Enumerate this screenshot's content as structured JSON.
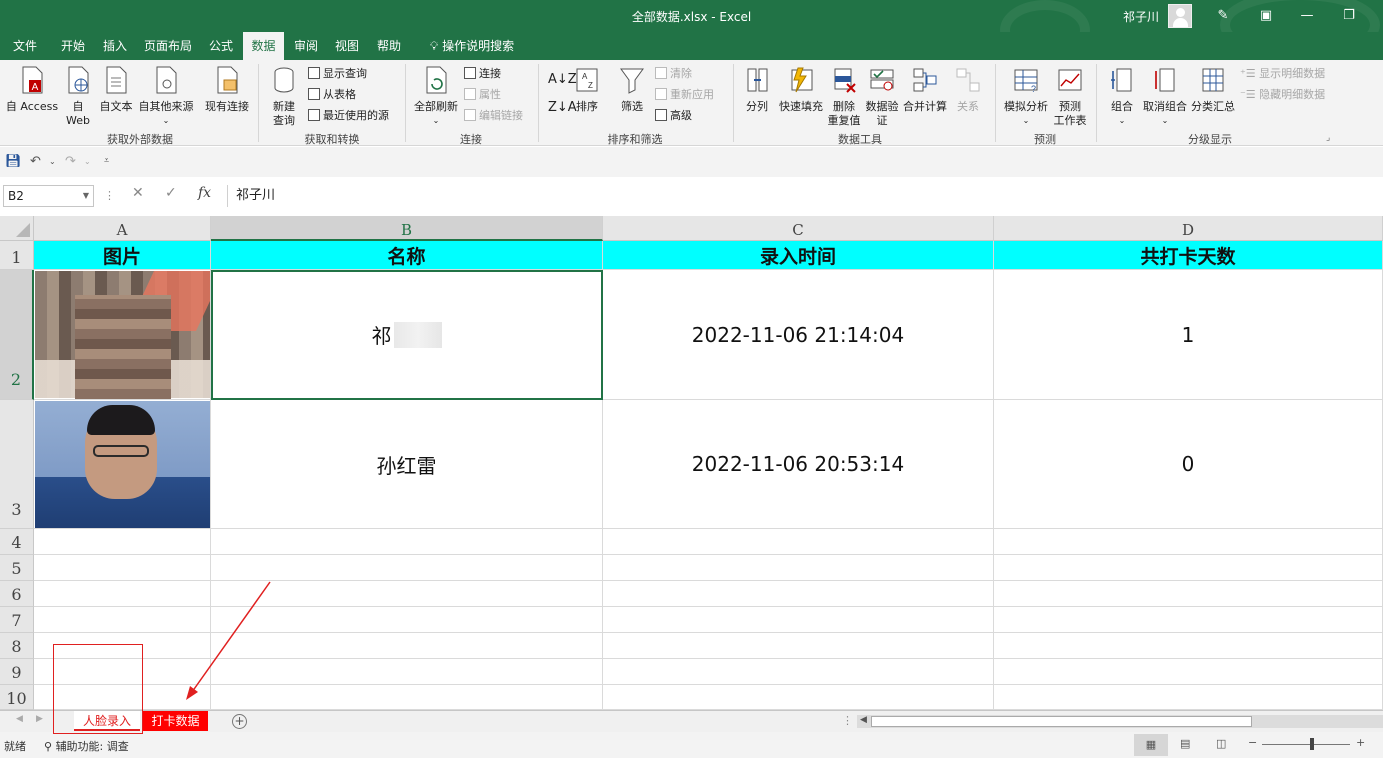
{
  "window": {
    "title": "全部数据.xlsx - Excel",
    "user_name": "祁子川"
  },
  "tabs": [
    "文件",
    "开始",
    "插入",
    "页面布局",
    "公式",
    "数据",
    "审阅",
    "视图",
    "帮助"
  ],
  "active_tab": "数据",
  "tell_me": "操作说明搜索",
  "ribbon": {
    "get_external": {
      "btn_access": "自 Access",
      "btn_web_1": "自",
      "btn_web_2": "Web",
      "btn_text": "自文本",
      "btn_other": "自其他来源",
      "btn_existing": "现有连接",
      "label": "获取外部数据"
    },
    "transform": {
      "btn_new_1": "新建",
      "btn_new_2": "查询",
      "show_query": "显示查询",
      "from_table": "从表格",
      "recent_sources": "最近使用的源",
      "label": "获取和转换"
    },
    "connections": {
      "btn_refresh": "全部刷新",
      "connections": "连接",
      "properties": "属性",
      "edit_links": "编辑链接",
      "label": "连接"
    },
    "sort_filter": {
      "btn_sort": "排序",
      "btn_filter": "筛选",
      "clear": "清除",
      "reapply": "重新应用",
      "advanced": "高级",
      "label": "排序和筛选"
    },
    "data_tools": {
      "btn_split": "分列",
      "btn_flash": "快速填充",
      "btn_dup_1": "删除",
      "btn_dup_2": "重复值",
      "btn_valid_1": "数据验",
      "btn_valid_2": "证",
      "btn_consolidate": "合并计算",
      "btn_relations": "关系",
      "label": "数据工具"
    },
    "forecast": {
      "btn_whatif": "模拟分析",
      "btn_sheet_1": "预测",
      "btn_sheet_2": "工作表",
      "label": "预测"
    },
    "outline": {
      "btn_group": "组合",
      "btn_ungroup": "取消组合",
      "btn_subtotal": "分类汇总",
      "show_detail": "显示明细数据",
      "hide_detail": "隐藏明细数据",
      "label": "分级显示"
    }
  },
  "formula_bar": {
    "name_box": "B2",
    "fx": "fx",
    "content": "祁子川"
  },
  "columns": [
    "A",
    "B",
    "C",
    "D"
  ],
  "rows": [
    "1",
    "2",
    "3",
    "4",
    "5",
    "6",
    "7",
    "8",
    "9",
    "10"
  ],
  "table": {
    "headers": [
      "图片",
      "名称",
      "录入时间",
      "共打卡天数"
    ],
    "records": [
      {
        "name": "祁",
        "time": "2022-11-06 21:14:04",
        "days": "1"
      },
      {
        "name": "孙红雷",
        "time": "2022-11-06 20:53:14",
        "days": "0"
      }
    ]
  },
  "sheets": [
    "人脸录入",
    "打卡数据"
  ],
  "status": {
    "ready": "就绪",
    "accessibility": "辅助功能: 调查"
  },
  "colors": {
    "excel_green": "#217346",
    "header_fill": "#00ffff",
    "annotation_red": "#e02020"
  }
}
